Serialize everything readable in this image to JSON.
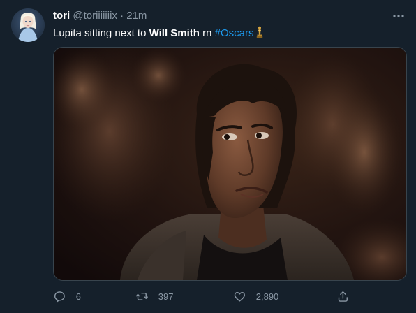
{
  "tweet": {
    "display_name": "tori",
    "handle": "@toriiiiiiix",
    "separator": "·",
    "time": "21m",
    "text_prefix": "Lupita sitting next to ",
    "text_bold": "Will Smith",
    "text_suffix": " rn ",
    "hashtag": "#Oscars",
    "hashtag_emoji": "oscar-statuette-icon",
    "media_icon": "photo-of-woman-in-theater",
    "more_icon": "more-horizontal-icon"
  },
  "actions": {
    "reply": {
      "icon": "reply-icon",
      "count": "6"
    },
    "retweet": {
      "icon": "retweet-icon",
      "count": "397"
    },
    "like": {
      "icon": "heart-icon",
      "count": "2,890"
    },
    "share": {
      "icon": "share-icon",
      "count": ""
    }
  },
  "colors": {
    "background": "#15202b",
    "text": "#ffffff",
    "secondary": "#8b98a5",
    "accent": "#1d9bf0",
    "border": "#38444d"
  }
}
